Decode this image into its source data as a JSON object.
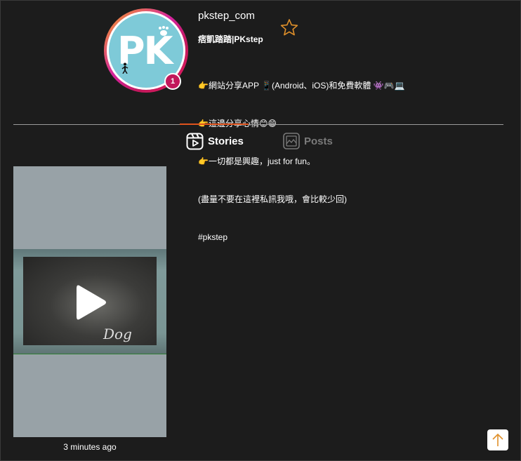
{
  "profile": {
    "username": "pkstep_com",
    "full_name": "痞凱踏踏|PKstep",
    "avatar_text": "PK",
    "story_count": "1",
    "bio_lines": [
      "👉網站分享APP 📱(Android、iOS)和免費軟體 👾🎮💻",
      "👉這邊分享心情😊😄",
      "👉一切都是興趣，just for fun。",
      "(盡量不要在這裡私訊我哦，會比較少回)",
      "#pkstep"
    ]
  },
  "tabs": [
    {
      "label": "Stories",
      "active": true,
      "icon": "reels-icon"
    },
    {
      "label": "Posts",
      "active": false,
      "icon": "image-icon"
    }
  ],
  "stories": [
    {
      "overlay_text": "Dog",
      "time": "3 minutes ago"
    }
  ],
  "colors": {
    "background": "#1c1c1c",
    "accent": "#e0531d",
    "badge": "#c2185b",
    "star": "#e0902a",
    "avatar_bg": "#7ecad8"
  }
}
